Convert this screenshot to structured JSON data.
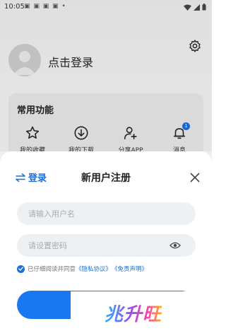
{
  "status_bar": {
    "time": "10:05",
    "notification_icons": "▣ ▣ ▣ ▣ •"
  },
  "profile": {
    "login_prompt": "点击登录"
  },
  "common_functions": {
    "title": "常用功能",
    "items": [
      {
        "label": "我的收藏",
        "icon": "star-icon"
      },
      {
        "label": "我的下载",
        "icon": "download-icon"
      },
      {
        "label": "分享APP",
        "icon": "add-user-icon"
      },
      {
        "label": "消息",
        "icon": "bell-icon",
        "badge": "1"
      }
    ]
  },
  "sheet": {
    "switch_label": "登录",
    "title": "新用户注册",
    "username_placeholder": "请输入用户名",
    "password_placeholder": "请设置密码",
    "agree_prefix": "已仔细阅读并同意",
    "privacy_link": "《隐私协议》",
    "disclaimer_link": "《免责声明》"
  },
  "watermark": "兆升旺",
  "colors": {
    "accent": "#1a6fd8",
    "button": "#1778f0"
  }
}
